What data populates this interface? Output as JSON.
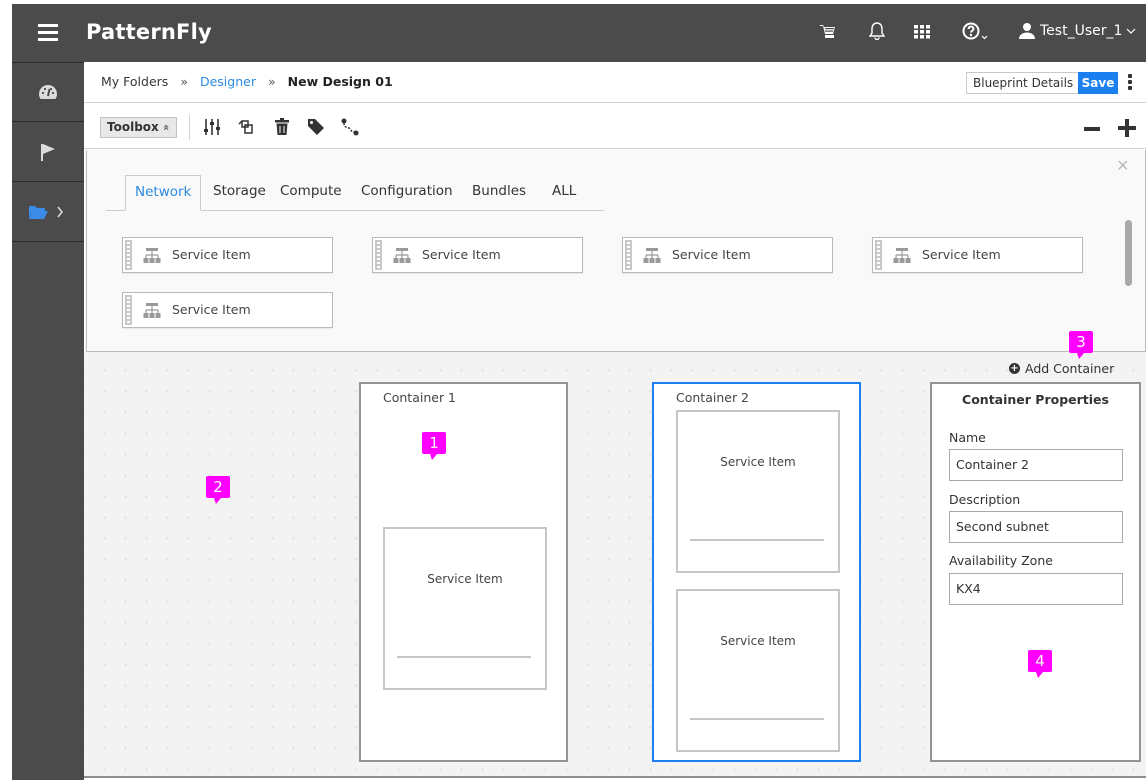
{
  "masthead": {
    "brand": "PatternFly",
    "icons": [
      "cart-icon",
      "bell-icon",
      "apps-grid-icon",
      "help-icon"
    ],
    "user": "Test_User_1"
  },
  "vertical_nav": {
    "items": [
      {
        "icon": "dashboard-icon",
        "active": false
      },
      {
        "icon": "flag-icon",
        "active": false
      },
      {
        "icon": "folder-open-icon",
        "active": true,
        "has_submenu": true
      }
    ]
  },
  "breadcrumb": {
    "items": [
      {
        "label": "My Folders",
        "link": false
      },
      {
        "label": "Designer",
        "link": true
      },
      {
        "label": "New Design 01",
        "current": true
      }
    ],
    "separator": "»"
  },
  "header_actions": {
    "blueprint_details": "Blueprint Details",
    "save": "Save"
  },
  "toolbar": {
    "toolbox_label": "Toolbox",
    "toolbox_chevron": "«",
    "tools": [
      "sliders-icon",
      "duplicate-icon",
      "trash-icon",
      "tag-icon",
      "connect-icon"
    ]
  },
  "toolbox": {
    "close": "×",
    "tabs": [
      {
        "label": "Network",
        "active": true
      },
      {
        "label": "Storage"
      },
      {
        "label": "Compute"
      },
      {
        "label": "Configuration"
      },
      {
        "label": "Bundles"
      },
      {
        "label": "ALL"
      }
    ],
    "items": [
      {
        "label": "Service Item"
      },
      {
        "label": "Service Item"
      },
      {
        "label": "Service Item"
      },
      {
        "label": "Service Item"
      },
      {
        "label": "Service Item"
      }
    ]
  },
  "canvas": {
    "add_container": "Add Container",
    "containers": [
      {
        "title": "Container 1",
        "selected": false,
        "items": [
          {
            "label": "Service Item"
          }
        ]
      },
      {
        "title": "Container 2",
        "selected": true,
        "items": [
          {
            "label": "Service Item"
          },
          {
            "label": "Service Item"
          }
        ]
      }
    ]
  },
  "properties": {
    "title": "Container Properties",
    "fields": [
      {
        "label": "Name",
        "value": "Container 2"
      },
      {
        "label": "Description",
        "value": "Second subnet"
      },
      {
        "label": "Availability Zone",
        "value": "KX4"
      }
    ]
  },
  "callouts": [
    "1",
    "2",
    "3",
    "4"
  ],
  "colors": {
    "masthead": "#4b4b4b",
    "accent": "#1b7ff0",
    "link": "#2b8ae0",
    "callout": "#ff00ff"
  }
}
